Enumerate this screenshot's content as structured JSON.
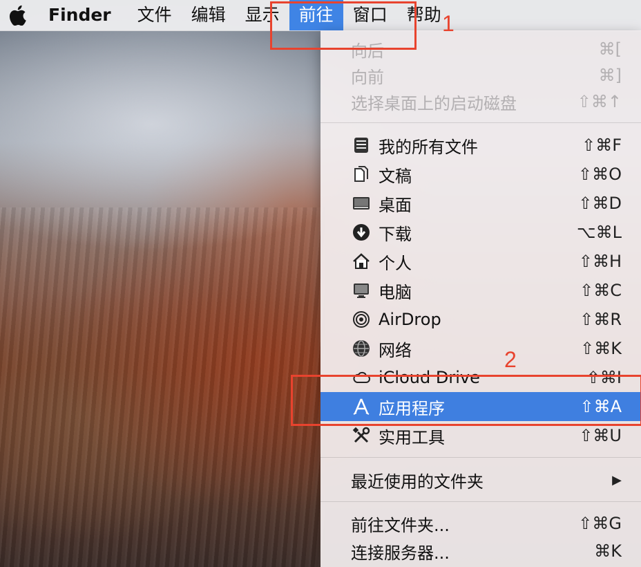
{
  "menubar": {
    "app_name": "Finder",
    "items": [
      "文件",
      "编辑",
      "显示",
      "前往",
      "窗口",
      "帮助"
    ]
  },
  "go_menu": {
    "group1": [
      {
        "label": "向后",
        "shortcut": "⌘["
      },
      {
        "label": "向前",
        "shortcut": "⌘]"
      },
      {
        "label": "选择桌面上的启动磁盘",
        "shortcut": "⇧⌘↑"
      }
    ],
    "group2": [
      {
        "label": "我的所有文件",
        "shortcut": "⇧⌘F",
        "icon": "all-files-icon"
      },
      {
        "label": "文稿",
        "shortcut": "⇧⌘O",
        "icon": "documents-icon"
      },
      {
        "label": "桌面",
        "shortcut": "⇧⌘D",
        "icon": "desktop-icon"
      },
      {
        "label": "下载",
        "shortcut": "⌥⌘L",
        "icon": "download-icon"
      },
      {
        "label": "个人",
        "shortcut": "⇧⌘H",
        "icon": "home-icon"
      },
      {
        "label": "电脑",
        "shortcut": "⇧⌘C",
        "icon": "computer-icon"
      },
      {
        "label": "AirDrop",
        "shortcut": "⇧⌘R",
        "icon": "airdrop-icon"
      },
      {
        "label": "网络",
        "shortcut": "⇧⌘K",
        "icon": "network-icon"
      },
      {
        "label": "iCloud Drive",
        "shortcut": "⇧⌘I",
        "icon": "icloud-icon"
      },
      {
        "label": "应用程序",
        "shortcut": "⇧⌘A",
        "icon": "applications-icon"
      },
      {
        "label": "实用工具",
        "shortcut": "⇧⌘U",
        "icon": "utilities-icon"
      }
    ],
    "recent": {
      "label": "最近使用的文件夹",
      "arrow": "▶"
    },
    "group4": [
      {
        "label": "前往文件夹...",
        "shortcut": "⇧⌘G"
      },
      {
        "label": "连接服务器...",
        "shortcut": "⌘K"
      }
    ]
  },
  "annotations": {
    "first": "1",
    "second": "2"
  },
  "colors": {
    "highlight": "#3f7fe0",
    "annotation": "#e8432e"
  }
}
